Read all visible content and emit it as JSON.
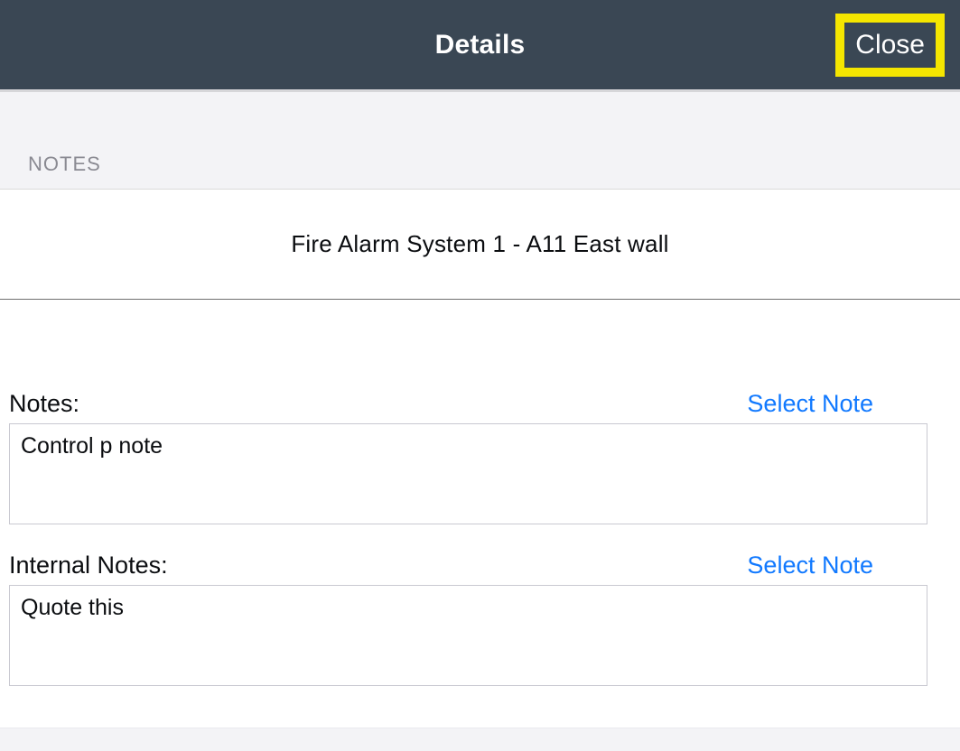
{
  "header": {
    "title": "Details",
    "close_label": "Close"
  },
  "section": {
    "label": "NOTES",
    "item_title": "Fire Alarm System 1 - A11 East wall"
  },
  "notes": {
    "label": "Notes:",
    "select_label": "Select Note",
    "value": "Control p note"
  },
  "internal_notes": {
    "label": "Internal Notes:",
    "select_label": "Select Note",
    "value": "Quote this"
  }
}
